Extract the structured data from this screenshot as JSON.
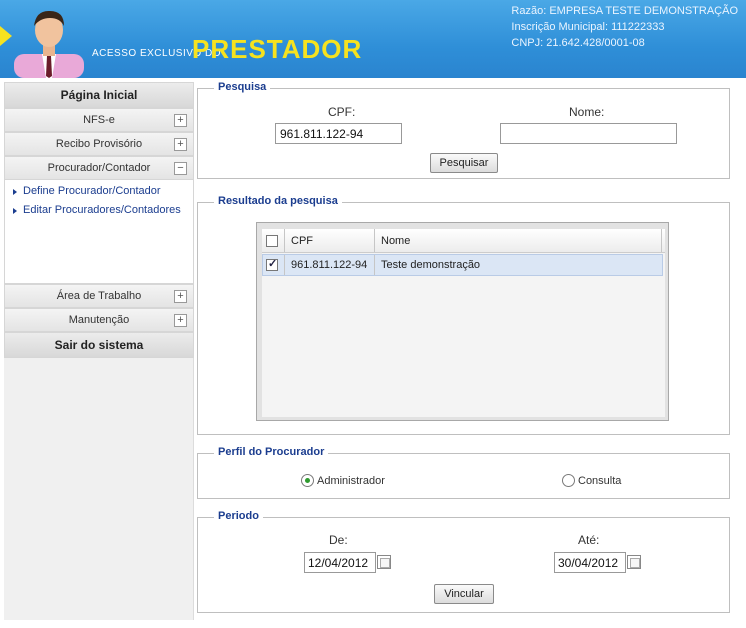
{
  "header": {
    "brand_small": "ACESSO EXCLUSIVO DO",
    "brand_big": "PRESTADOR",
    "company_name": "Razão: EMPRESA TESTE DEMONSTRAÇÃO",
    "municipal_registration": "Inscrição Municipal: 111222333",
    "cnpj": "CNPJ: 21.642.428/0001-08"
  },
  "sidebar": {
    "home": "Página Inicial",
    "items": [
      {
        "label": "NFS-e",
        "toggle": "+"
      },
      {
        "label": "Recibo Provisório",
        "toggle": "+"
      },
      {
        "label": "Procurador/Contador",
        "toggle": "−"
      }
    ],
    "sublinks": [
      "Define Procurador/Contador",
      "Editar Procuradores/Contadores"
    ],
    "items_after": [
      {
        "label": "Área de Trabalho",
        "toggle": "+"
      },
      {
        "label": "Manutenção",
        "toggle": "+"
      }
    ],
    "logout": "Sair do sistema"
  },
  "search": {
    "legend": "Pesquisa",
    "cpf_label": "CPF:",
    "cpf_value": "961.811.122-94",
    "name_label": "Nome:",
    "name_value": "",
    "button": "Pesquisar"
  },
  "results": {
    "legend": "Resultado da pesquisa",
    "columns": [
      "CPF",
      "Nome"
    ],
    "rows": [
      {
        "checked": true,
        "cpf": "961.811.122-94",
        "name": "Teste demonstração"
      }
    ]
  },
  "profile": {
    "legend": "Perfil do Procurador",
    "options": [
      {
        "label": "Administrador",
        "selected": true
      },
      {
        "label": "Consulta",
        "selected": false
      }
    ]
  },
  "period": {
    "legend": "Periodo",
    "from_label": "De:",
    "from_value": "12/04/2012",
    "to_label": "Até:",
    "to_value": "30/04/2012",
    "button": "Vincular"
  }
}
